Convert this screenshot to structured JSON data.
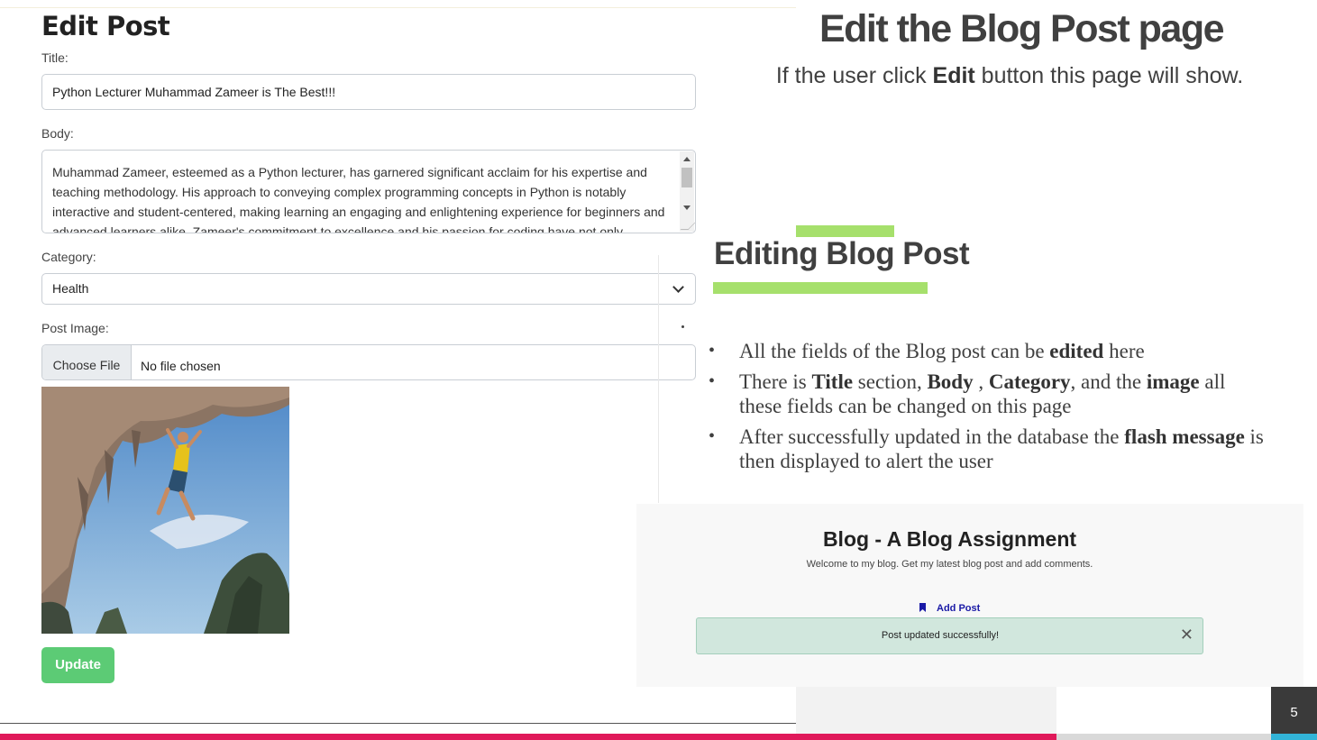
{
  "form": {
    "heading": "Edit Post",
    "title_label": "Title:",
    "title_value": "Python Lecturer Muhammad Zameer is The Best!!!",
    "body_label": "Body:",
    "body_value": "Muhammad Zameer, esteemed as a Python lecturer, has garnered significant acclaim for his expertise and teaching methodology. His approach to conveying complex programming concepts in Python is notably interactive and student-centered, making learning an engaging and enlightening experience for beginners and advanced learners alike. Zameer's commitment to excellence and his passion for coding have not only",
    "category_label": "Category:",
    "category_value": "Health",
    "image_label": "Post Image:",
    "file_button": "Choose File",
    "file_status": "No file chosen",
    "update_label": "Update"
  },
  "slide": {
    "title": "Edit  the Blog Post page",
    "subtitle_pre": "If the user click ",
    "subtitle_bold": "Edit",
    "subtitle_post": " button this page will show.",
    "heading": "Editing Blog Post",
    "page_number": "5",
    "bullets": [
      {
        "t1": "All the fields of the Blog post can be ",
        "b1": "edited",
        "t2": " here"
      },
      {
        "t1": "There is ",
        "b1": "Title",
        "t2": " section, ",
        "b2": "Body",
        "t3": " , ",
        "b3": "Category",
        "t4": ", and the ",
        "b4": "image",
        "t5": " all these fields can be changed on this page"
      },
      {
        "t1": "After successfully updated in the database the ",
        "b1": "flash message",
        "t2": " is then displayed to alert the user"
      }
    ]
  },
  "flash_screenshot": {
    "blog_title": "Blog - A Blog Assignment",
    "welcome": "Welcome to my blog. Get my latest blog post and add comments.",
    "add_post": "Add Post",
    "message": "Post updated successfully!",
    "close_glyph": "✕"
  },
  "colors": {
    "accent_green": "#a6e06c",
    "update_button": "#5ccb75",
    "flash_bg": "#d1e7dd",
    "pink_bar": "#e0195a",
    "cyan_bar": "#32b4d8"
  },
  "icons": [
    "chevron-down-icon",
    "bookmark-icon",
    "close-icon"
  ]
}
